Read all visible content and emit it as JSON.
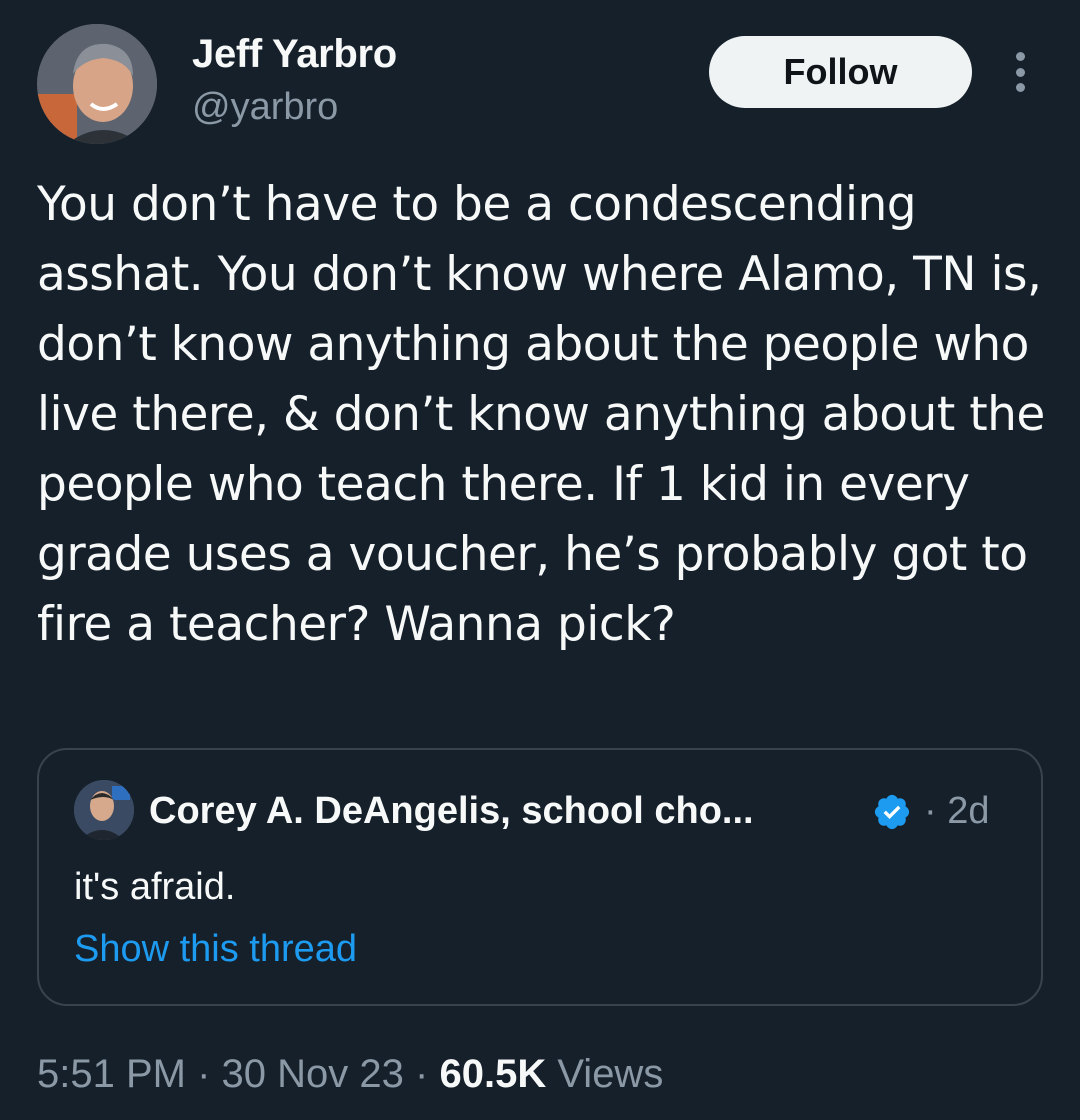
{
  "author": {
    "name": "Jeff Yarbro",
    "handle": "@yarbro",
    "follow_label": "Follow"
  },
  "tweet": {
    "text": "You don’t have to be a condescending asshat. You don’t know where Alamo, TN is, don’t know anything about the people who live there, & don’t know anything about the people who teach there. If 1 kid in every grade uses a voucher, he’s probably got to fire a teacher? Wanna pick?"
  },
  "quoted_tweet": {
    "author_name": "Corey A. DeAngelis, school cho...",
    "time_sep": "·",
    "time": "2d",
    "text": "it's afraid.",
    "show_thread_label": "Show this thread"
  },
  "meta": {
    "time": "5:51 PM",
    "sep1": "·",
    "date": "30 Nov 23",
    "sep2": "·",
    "views_count": "60.5K",
    "views_label": "Views"
  },
  "colors": {
    "background": "#15202b",
    "accent": "#1d9bf0",
    "muted": "#8b98a5",
    "border": "#38444d"
  },
  "icons": [
    "more-options-icon",
    "verified-badge-icon"
  ]
}
